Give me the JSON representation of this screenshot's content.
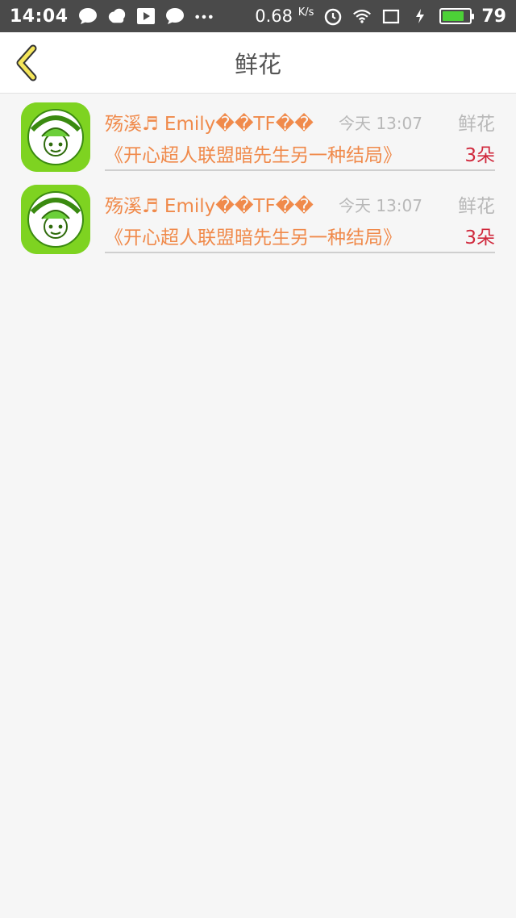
{
  "status_bar": {
    "time": "14:04",
    "net_speed": "0.68",
    "net_unit": "K/s",
    "battery": "79",
    "battery_level": 0.79,
    "icons": [
      "chat-bubble-icon",
      "cloud-icon",
      "play-icon",
      "chat-bubble-icon",
      "more-dots-icon",
      "alarm-icon",
      "wifi-icon",
      "sim-icon",
      "charging-icon",
      "battery-icon"
    ]
  },
  "header": {
    "title": "鲜花"
  },
  "items": [
    {
      "username": "殇溪♬ Emily��TF��",
      "time": "今天 13:07",
      "gift_type": "鲜花",
      "book_title": "《开心超人联盟暗先生另一种结局》",
      "gift_count": "3朵"
    },
    {
      "username": "殇溪♬ Emily��TF��",
      "time": "今天 13:07",
      "gift_type": "鲜花",
      "book_title": "《开心超人联盟暗先生另一种结局》",
      "gift_count": "3朵"
    }
  ],
  "colors": {
    "accent_orange": "#f08a4b",
    "count_red": "#d0283c",
    "back_arrow_yellow": "#f5e65a",
    "avatar_green": "#7ed321"
  }
}
